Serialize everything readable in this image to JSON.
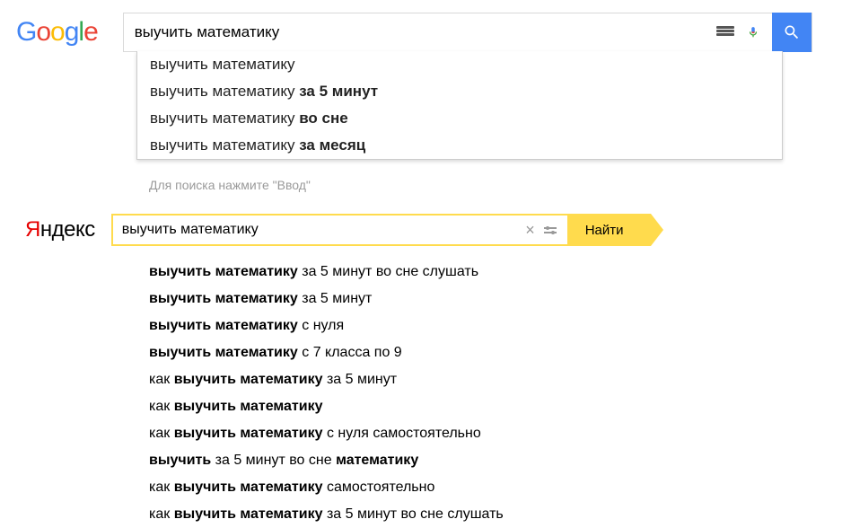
{
  "google": {
    "logo_letters": [
      "G",
      "o",
      "o",
      "g",
      "l",
      "e"
    ],
    "query": "выучить математику",
    "suggestions": [
      {
        "base": "выучить математику",
        "bold": ""
      },
      {
        "base": "выучить математику ",
        "bold": "за 5 минут"
      },
      {
        "base": "выучить математику ",
        "bold": "во сне"
      },
      {
        "base": "выучить математику ",
        "bold": "за месяц"
      }
    ],
    "hint": "Для поиска нажмите \"Ввод\""
  },
  "yandex": {
    "logo_y": "Я",
    "logo_rest": "ндекс",
    "query": "выучить математику",
    "find_label": "Найти",
    "suggestions": [
      {
        "pre": "",
        "bold": "выучить математику",
        "post": " за 5 минут во сне слушать"
      },
      {
        "pre": "",
        "bold": "выучить математику",
        "post": " за 5 минут"
      },
      {
        "pre": "",
        "bold": "выучить математику",
        "post": " с нуля"
      },
      {
        "pre": "",
        "bold": "выучить математику",
        "post": " с 7 класса по 9"
      },
      {
        "pre": "как ",
        "bold": "выучить математику",
        "post": " за 5 минут"
      },
      {
        "pre": "как ",
        "bold": "выучить математику",
        "post": ""
      },
      {
        "pre": "как ",
        "bold": "выучить математику",
        "post": " с нуля самостоятельно"
      },
      {
        "pre": "",
        "bold": "выучить",
        "post": " за 5 минут во сне ",
        "bold2": "математику",
        "post2": ""
      },
      {
        "pre": "как ",
        "bold": "выучить математику",
        "post": " самостоятельно"
      },
      {
        "pre": "как ",
        "bold": "выучить математику",
        "post": " за 5 минут во сне слушать"
      }
    ]
  }
}
